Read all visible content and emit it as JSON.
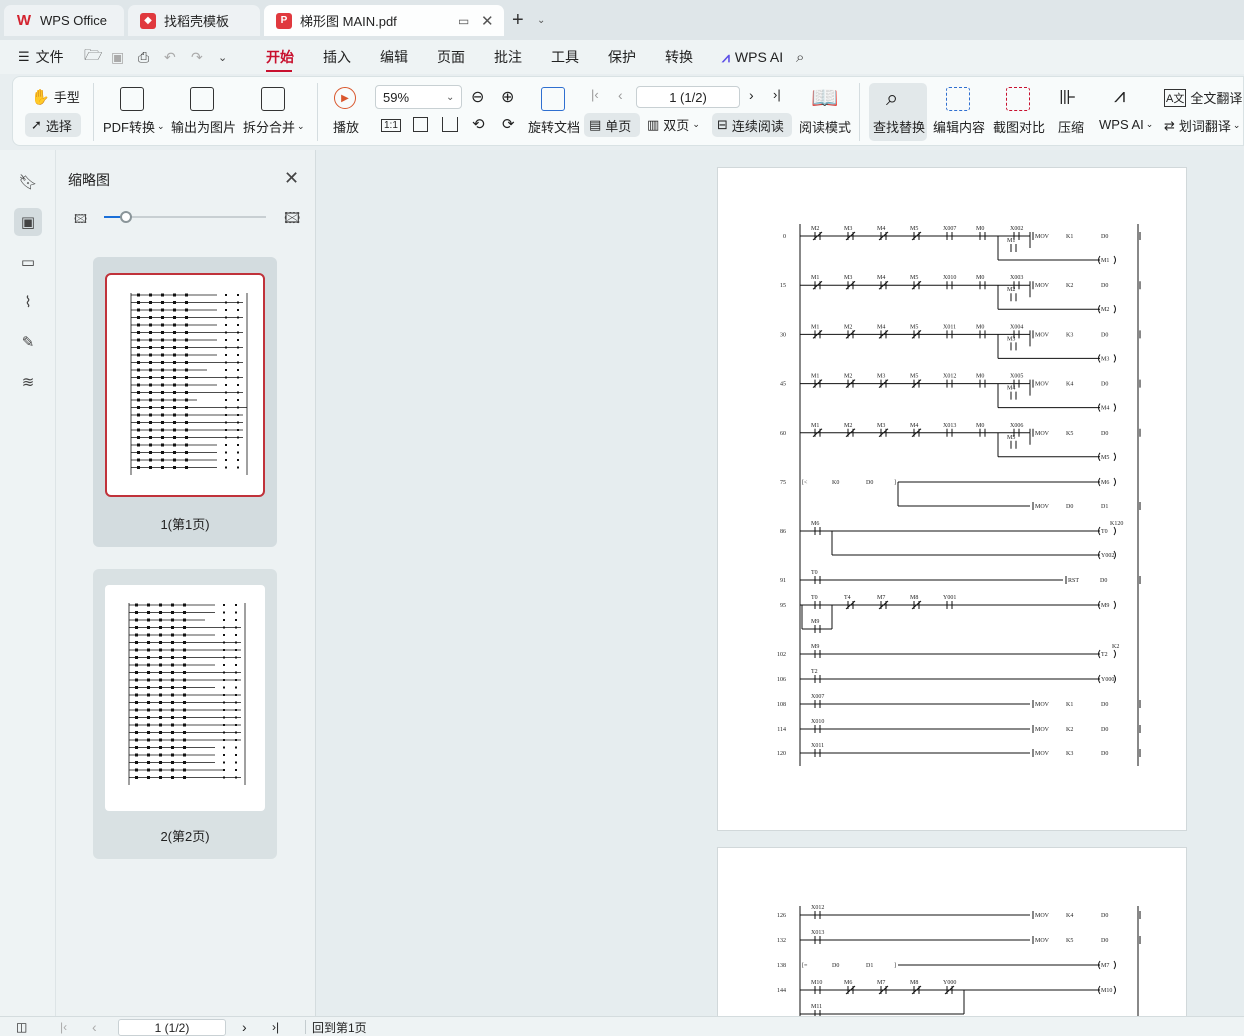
{
  "tabs": [
    {
      "label": "WPS Office",
      "icon": "wps-logo-icon"
    },
    {
      "label": "找稻壳模板",
      "icon": "docer-icon"
    },
    {
      "label": "梯形图 MAIN.pdf",
      "icon": "pdf-icon",
      "active": true
    }
  ],
  "menu": {
    "file": "文件",
    "items": [
      "开始",
      "插入",
      "编辑",
      "页面",
      "批注",
      "工具",
      "保护",
      "转换"
    ],
    "ai": "WPS AI"
  },
  "ribbon": {
    "hand": "手型",
    "select": "选择",
    "pdf_convert": "PDF转换",
    "export_image": "输出为图片",
    "split_merge": "拆分合并",
    "play": "播放",
    "zoom": "59%",
    "page": "1 (1/2)",
    "rotate": "旋转文档",
    "single": "单页",
    "double": "双页",
    "continuous": "连续阅读",
    "read_mode": "阅读模式",
    "find_replace": "查找替换",
    "edit_content": "编辑内容",
    "screenshot_compare": "截图对比",
    "compress": "压缩",
    "wps_ai": "WPS AI",
    "full_translate": "全文翻译",
    "word_translate": "划词翻译"
  },
  "thumbnail_panel": {
    "title": "缩略图",
    "pages": [
      {
        "label": "1(第1页)",
        "selected": true
      },
      {
        "label": "2(第2页)",
        "selected": false
      }
    ]
  },
  "ladder_page1": [
    {
      "step": "0",
      "contacts": [
        "M2",
        "M3",
        "M4",
        "M5",
        "X007",
        "M0",
        "X002"
      ],
      "branch": "M1",
      "out": "MOV",
      "k": "K1",
      "d": "D0",
      "coil2": "M1"
    },
    {
      "step": "15",
      "contacts": [
        "M1",
        "M3",
        "M4",
        "M5",
        "X010",
        "M0",
        "X003"
      ],
      "branch": "M2",
      "out": "MOV",
      "k": "K2",
      "d": "D0",
      "coil2": "M2"
    },
    {
      "step": "30",
      "contacts": [
        "M1",
        "M2",
        "M4",
        "M5",
        "X011",
        "M0",
        "X004"
      ],
      "branch": "M3",
      "out": "MOV",
      "k": "K3",
      "d": "D0",
      "coil2": "M3"
    },
    {
      "step": "45",
      "contacts": [
        "M1",
        "M2",
        "M3",
        "M5",
        "X012",
        "M0",
        "X005"
      ],
      "branch": "M4",
      "out": "MOV",
      "k": "K4",
      "d": "D0",
      "coil2": "M4"
    },
    {
      "step": "60",
      "contacts": [
        "M1",
        "M2",
        "M3",
        "M4",
        "X013",
        "M0",
        "X006"
      ],
      "branch": "M5",
      "out": "MOV",
      "k": "K5",
      "d": "D0",
      "coil2": "M5"
    }
  ],
  "ladder_page1_misc": [
    {
      "step": "75",
      "a": "K0",
      "b": "D0",
      "coil": "M6",
      "mov": "MOV",
      "mova": "D0",
      "movb": "D1"
    },
    {
      "step": "86",
      "contact": "M6",
      "coil": "T0",
      "k": "K120",
      "coil2": "Y002"
    },
    {
      "step": "91",
      "contact": "T0",
      "rst": "RST",
      "d": "D0"
    },
    {
      "step": "95",
      "contacts": [
        "T0",
        "T4",
        "M7",
        "M8",
        "Y001"
      ],
      "branch": "M9",
      "coil": "M9"
    },
    {
      "step": "102",
      "contact": "M9",
      "coil": "T2",
      "k": "K2"
    },
    {
      "step": "106",
      "contact": "T2",
      "coil": "Y000"
    },
    {
      "step": "108",
      "contact": "X007",
      "mov": "MOV",
      "k": "K1",
      "d": "D0"
    },
    {
      "step": "114",
      "contact": "X010",
      "mov": "MOV",
      "k": "K2",
      "d": "D0"
    },
    {
      "step": "120",
      "contact": "X011",
      "mov": "MOV",
      "k": "K3",
      "d": "D0"
    }
  ],
  "ladder_page2": [
    {
      "step": "126",
      "contact": "X012",
      "mov": "MOV",
      "k": "K4",
      "d": "D0"
    },
    {
      "step": "132",
      "contact": "X013",
      "mov": "MOV",
      "k": "K5",
      "d": "D0"
    },
    {
      "step": "138",
      "a": "D0",
      "b": "D1",
      "coil": "M7"
    },
    {
      "step": "144",
      "contacts": [
        "M10",
        "M6",
        "M7",
        "M8",
        "Y000"
      ],
      "branch": "M11",
      "coil": "M10"
    }
  ],
  "status": {
    "page": "1 (1/2)",
    "back_to_first": "回到第1页"
  }
}
